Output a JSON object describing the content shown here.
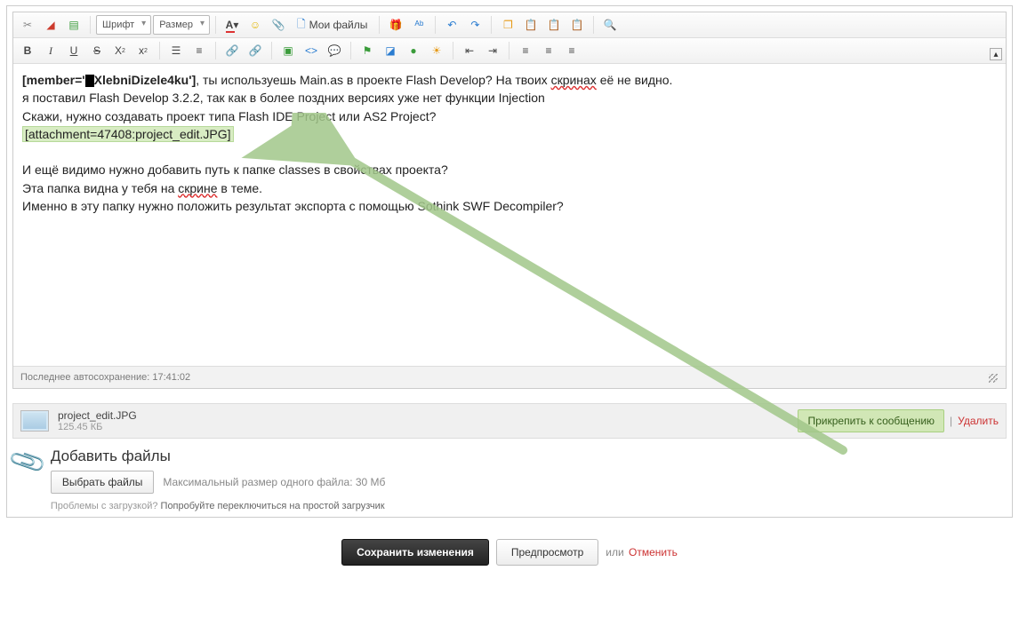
{
  "toolbar": {
    "font_label": "Шрифт",
    "size_label": "Размер",
    "my_files_label": "Мои файлы"
  },
  "content": {
    "line1_prefix": "[member='",
    "line1_name": "XlebniDizele4ku'",
    "line1_bracket": "]",
    "line1_rest_a": ", ты используешь Main.as в проекте Flash Develop? На твоих ",
    "line1_wavy": "скринах",
    "line1_rest_b": " её не видно.",
    "line2": "я поставил Flash Develop 3.2.2, так как в более поздних версиях уже нет функции Injection",
    "line3": "Скажи, нужно создавать проект типа Flash IDE Project или AS2 Project?",
    "attach_text": "[attachment=47408:project_edit.JPG]",
    "line5": "И ещё видимо нужно добавить путь к папке classes в свойствах проекта?",
    "line6_a": "Эта папка видна у тебя на ",
    "line6_wavy": "скрине",
    "line6_b": " в теме.",
    "line7": "Именно в эту папку нужно положить результат экспорта с помощью Sothink SWF Decompiler?"
  },
  "footer": {
    "autosave": "Последнее автосохранение: 17:41:02"
  },
  "file": {
    "name": "project_edit.JPG",
    "size": "125.45 КБ",
    "attach_label": "Прикрепить к сообщению",
    "divider": "|",
    "delete_label": "Удалить"
  },
  "upload": {
    "heading": "Добавить файлы",
    "choose_label": "Выбрать файлы",
    "max_hint": "Максимальный размер одного файла: 30 Мб",
    "problems_a": "Проблемы с загрузкой? ",
    "problems_link": "Попробуйте переключиться на простой загрузчик"
  },
  "actions": {
    "save": "Сохранить изменения",
    "preview": "Предпросмотр",
    "or": "или",
    "cancel": "Отменить"
  }
}
